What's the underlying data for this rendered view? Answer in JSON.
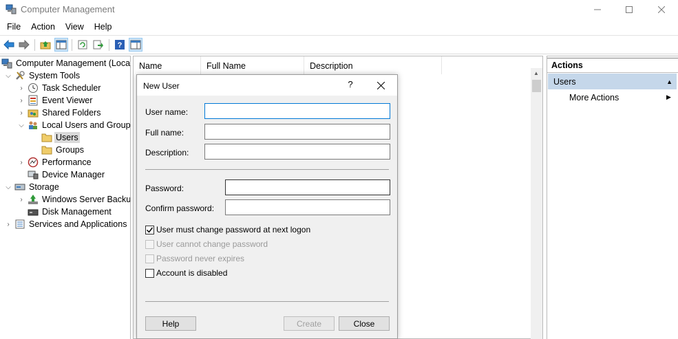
{
  "window": {
    "title": "Computer Management",
    "controls": {
      "minimize": "—",
      "maximize": "☐",
      "close": "✕"
    }
  },
  "menu": {
    "items": [
      "File",
      "Action",
      "View",
      "Help"
    ]
  },
  "tree": {
    "items": [
      {
        "label": "Computer Management (Local",
        "icon": "computer-management-icon",
        "arrow": "",
        "level": 0
      },
      {
        "label": "System Tools",
        "icon": "tools-icon",
        "arrow": "expanded",
        "level": 1
      },
      {
        "label": "Task Scheduler",
        "icon": "clock-icon",
        "arrow": "collapsed",
        "level": 2
      },
      {
        "label": "Event Viewer",
        "icon": "event-viewer-icon",
        "arrow": "collapsed",
        "level": 2
      },
      {
        "label": "Shared Folders",
        "icon": "shared-folder-icon",
        "arrow": "collapsed",
        "level": 2
      },
      {
        "label": "Local Users and Groups",
        "icon": "users-group-icon",
        "arrow": "expanded",
        "level": 2
      },
      {
        "label": "Users",
        "icon": "folder-icon",
        "arrow": "",
        "level": 3,
        "selected": true
      },
      {
        "label": "Groups",
        "icon": "folder-icon",
        "arrow": "",
        "level": 3
      },
      {
        "label": "Performance",
        "icon": "performance-icon",
        "arrow": "collapsed",
        "level": 2
      },
      {
        "label": "Device Manager",
        "icon": "device-manager-icon",
        "arrow": "",
        "level": 2
      },
      {
        "label": "Storage",
        "icon": "storage-icon",
        "arrow": "expanded",
        "level": 1
      },
      {
        "label": "Windows Server Backup",
        "icon": "backup-icon",
        "arrow": "collapsed",
        "level": 2
      },
      {
        "label": "Disk Management",
        "icon": "disk-icon",
        "arrow": "",
        "level": 2
      },
      {
        "label": "Services and Applications",
        "icon": "services-icon",
        "arrow": "collapsed",
        "level": 1
      }
    ]
  },
  "list": {
    "columns": [
      "Name",
      "Full Name",
      "Description"
    ]
  },
  "actions": {
    "title": "Actions",
    "group": "Users",
    "more": "More Actions"
  },
  "dialog": {
    "title": "New User",
    "help": "?",
    "fields": {
      "username_label": "User name:",
      "username_value": "",
      "fullname_label": "Full name:",
      "fullname_value": "",
      "description_label": "Description:",
      "description_value": "",
      "password_label": "Password:",
      "password_value": "",
      "confirm_label": "Confirm password:",
      "confirm_value": ""
    },
    "checks": {
      "must_change": {
        "label": "User must change password at next logon",
        "checked": true,
        "disabled": false
      },
      "cannot_change": {
        "label": "User cannot change password",
        "checked": false,
        "disabled": true
      },
      "never_expires": {
        "label": "Password never expires",
        "checked": false,
        "disabled": true
      },
      "disabled": {
        "label": "Account is disabled",
        "checked": false,
        "disabled": false
      }
    },
    "buttons": {
      "help": "Help",
      "create": "Create",
      "close": "Close"
    }
  }
}
